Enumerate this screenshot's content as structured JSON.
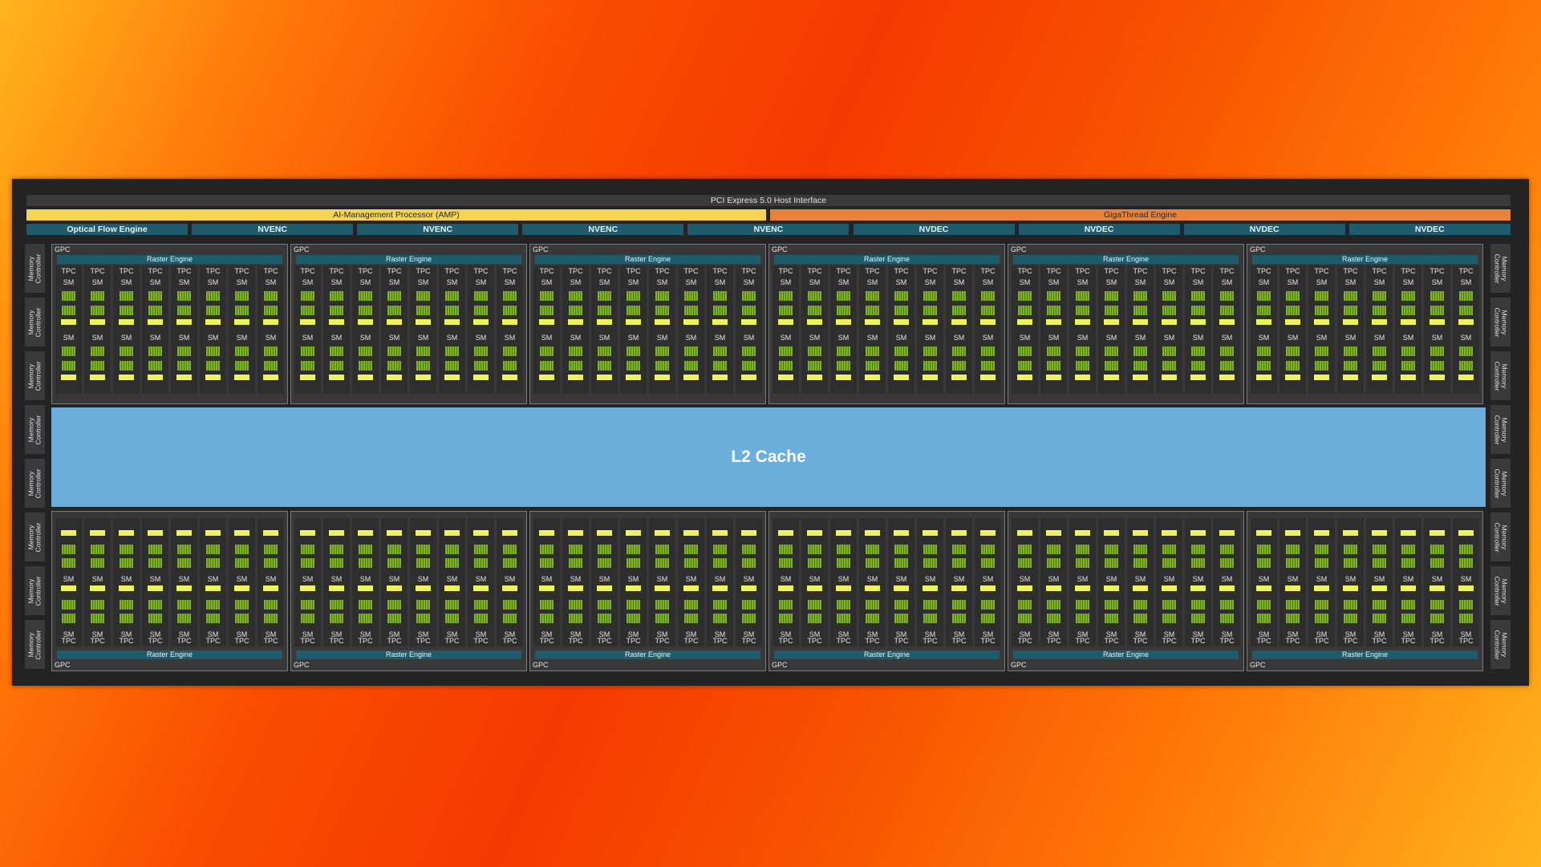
{
  "host_interface": "PCI Express 5.0 Host Interface",
  "amp": "AI-Management Processor (AMP)",
  "gigathread": "GigaThread Engine",
  "engines": [
    "Optical Flow Engine",
    "NVENC",
    "NVENC",
    "NVENC",
    "NVENC",
    "NVDEC",
    "NVDEC",
    "NVDEC",
    "NVDEC"
  ],
  "memory_controller": "Memory Controller",
  "l2_cache": "L2 Cache",
  "gpc_label": "GPC",
  "raster_label": "Raster Engine",
  "tpc_label": "TPC",
  "sm_label": "SM",
  "colors": {
    "background_gradient": [
      "#ffb51c",
      "#f53a00",
      "#ffb41e"
    ],
    "chip": "#232323",
    "amp": "#f4d452",
    "gigathread": "#e8833c",
    "engine": "#1d5b6d",
    "l2_cache": "#6baedc",
    "cuda_cores": "#7eb321",
    "tensor_cores": "#eef25c"
  }
}
